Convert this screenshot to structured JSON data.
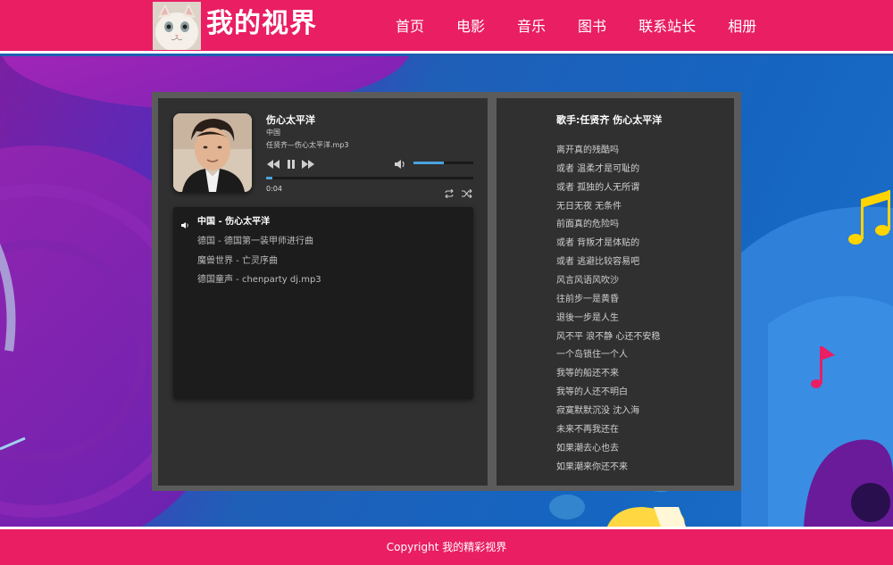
{
  "header": {
    "site_title": "我的视界",
    "nav": [
      "首页",
      "电影",
      "音乐",
      "图书",
      "联系站长",
      "相册"
    ]
  },
  "player": {
    "song_title": "伤心太平洋",
    "artist": "中国",
    "file": "任贤齐—伤心太平洋.mp3",
    "current_time": "0:04",
    "progress_fraction": 0.03,
    "volume_fraction": 0.5,
    "controls": [
      "prev-icon",
      "pause-icon",
      "next-icon",
      "volume-icon",
      "repeat-icon",
      "shuffle-icon"
    ]
  },
  "playlist": [
    {
      "text": "中国 - 伤心太平洋",
      "active": true
    },
    {
      "text": "德国 - 德国第一装甲师进行曲",
      "active": false
    },
    {
      "text": "魔兽世界 - 亡灵序曲",
      "active": false
    },
    {
      "text": "德国童声 - chenparty dj.mp3",
      "active": false
    }
  ],
  "lyrics": {
    "title": "歌手:任贤齐 伤心太平洋",
    "lines": [
      "离开真的残酷吗",
      "或者 温柔才是可耻的",
      "或者 孤独的人无所谓",
      "无日无夜 无条件",
      "前面真的危险吗",
      "或者 背叛才是体贴的",
      "或者 逃避比较容易吧",
      "风言风语风吹沙",
      "往前步一是黄昏",
      "退後一步是人生",
      "风不平 浪不静 心还不安稳",
      "一个岛锁住一个人",
      "我等的船还不来",
      "我等的人还不明白",
      "寂寞默默沉没 沈入海",
      "未来不再我还在",
      "如果潮去心也去",
      "如果潮来你还不来"
    ]
  },
  "footer": {
    "copyright": "Copyright 我的精彩视界"
  },
  "colors": {
    "brand": "#e91e63",
    "accent": "#4aa3df",
    "panel": "#303030"
  }
}
